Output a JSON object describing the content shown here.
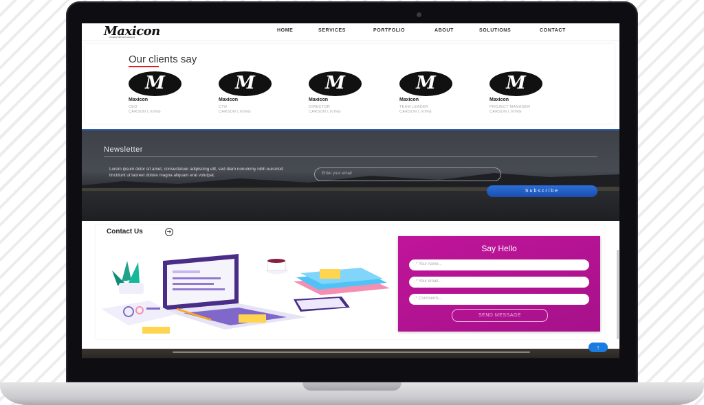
{
  "nav": {
    "logo": "Maxicon",
    "tagline": "Creating high-tech solutions",
    "links": [
      "HOME",
      "SERVICES",
      "PORTFOLIO",
      "ABOUT",
      "SOLUTIONS",
      "CONTACT"
    ]
  },
  "clients": {
    "title": "Our clients say",
    "items": [
      {
        "logo_letter": "M",
        "name": "Maxicon",
        "role": "CEO",
        "company": "CARSON LIVING"
      },
      {
        "logo_letter": "M",
        "name": "Maxicon",
        "role": "CTO",
        "company": "CARSON LIVING"
      },
      {
        "logo_letter": "M",
        "name": "Maxicon",
        "role": "DIRECTOR",
        "company": "CARSON LIVING"
      },
      {
        "logo_letter": "M",
        "name": "Maxicon",
        "role": "TEAM LEADER",
        "company": "CARSON LIVING"
      },
      {
        "logo_letter": "M",
        "name": "Maxicon",
        "role": "PROJECT MANAGER",
        "company": "CARSON LIVING"
      }
    ]
  },
  "newsletter": {
    "title": "Newsletter",
    "text": "Lorem ipsum dolor sit amet, consectetuer adipiscing elit, sed diam nonummy nibh euismod tincidunt ut laoreet dolore magna aliquam erat volutpat.",
    "input_placeholder": "Enter your email",
    "button_label": "Subscribe"
  },
  "contact": {
    "title": "Contact Us",
    "arrow_icon": "arrow-right-circle-icon",
    "form": {
      "title": "Say Hello",
      "name_placeholder": "* Your name...",
      "email_placeholder": "* Your email...",
      "comments_placeholder": "* Comments...",
      "send_label": "SEND MESSAGE"
    }
  },
  "scroll_top_icon": "arrow-up-icon",
  "colors": {
    "accent_red": "#e02020",
    "subscribe_blue": "#1a4fb0",
    "form_magenta": "#b3128f",
    "to_top_blue": "#1a7be0"
  }
}
